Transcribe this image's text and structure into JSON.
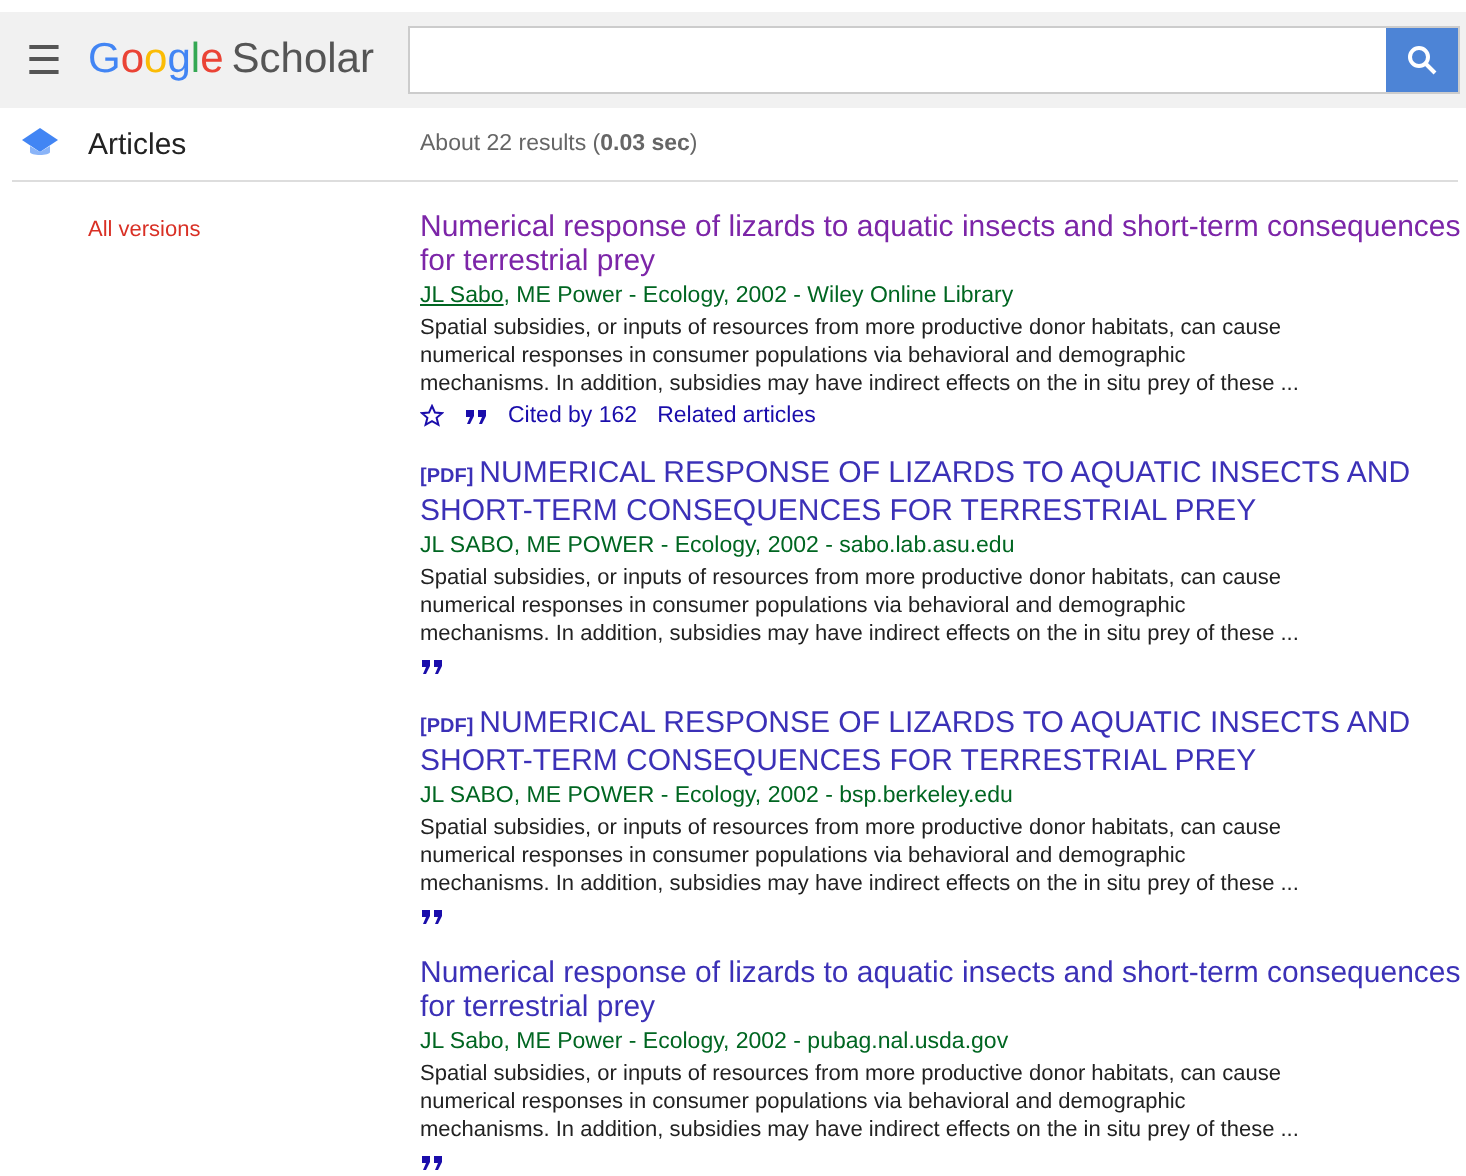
{
  "header": {
    "menu": "☰",
    "logo": [
      {
        "text": "G",
        "color": "#4285f4"
      },
      {
        "text": "o",
        "color": "#ea4335"
      },
      {
        "text": "o",
        "color": "#fbbc05"
      },
      {
        "text": "g",
        "color": "#4285f4"
      },
      {
        "text": "l",
        "color": "#34a853"
      },
      {
        "text": "e",
        "color": "#ea4335"
      }
    ],
    "logo_suffix": "Scholar"
  },
  "section": {
    "title": "Articles",
    "results_count": "About 22 results (**0.03 sec**)"
  },
  "sidebar": {
    "link": "All versions"
  },
  "results": [
    {
      "title": "Numerical response of lizards to aquatic insects and short-term consequences for terrestrial prey",
      "visited": true,
      "author_link": "JL Sabo",
      "source": ", ME Power - Ecology, 2002 - Wiley Online Library",
      "snippet_lines": [
        "Spatial subsidies, or inputs of resources from more productive donor habitats, can cause",
        "numerical responses in consumer populations via behavioral and demographic",
        "mechanisms. In addition, subsidies may have indirect effects on the in situ prey of these ..."
      ],
      "actions": [
        "Cited by 162",
        "Related articles"
      ],
      "starred": false
    },
    {
      "tag": "[PDF]",
      "title": "NUMERICAL RESPONSE OF LIZARDS TO AQUATIC INSECTS AND SHORT-TERM CONSEQUENCES FOR TERRESTRIAL PREY",
      "visited": false,
      "source": "JL SABO, ME POWER - Ecology, 2002 - sabo.lab.asu.edu",
      "snippet_lines": [
        "Spatial subsidies, or inputs of resources from more productive donor habitats, can cause",
        "numerical responses in consumer populations via behavioral and demographic",
        "mechanisms. In addition, subsidies may have indirect effects on the in situ prey of these ..."
      ]
    },
    {
      "tag": "[PDF]",
      "title": "NUMERICAL RESPONSE OF LIZARDS TO AQUATIC INSECTS AND SHORT-TERM CONSEQUENCES FOR TERRESTRIAL PREY",
      "visited": false,
      "source": "JL SABO, ME POWER - Ecology, 2002 - bsp.berkeley.edu",
      "snippet_lines": [
        "Spatial subsidies, or inputs of resources from more productive donor habitats, can cause",
        "numerical responses in consumer populations via behavioral and demographic",
        "mechanisms. In addition, subsidies may have indirect effects on the in situ prey of these ..."
      ]
    },
    {
      "title": "Numerical response of lizards to aquatic insects and short-term consequences for terrestrial prey",
      "visited": false,
      "source": "JL Sabo, ME Power - Ecology, 2002 - pubag.nal.usda.gov",
      "snippet_lines": [
        "Spatial subsidies, or inputs of resources from more productive donor habitats, can cause",
        "numerical responses in consumer populations via behavioral and demographic",
        "mechanisms. In addition, subsidies may have indirect effects on the in situ prey of these ..."
      ]
    }
  ]
}
